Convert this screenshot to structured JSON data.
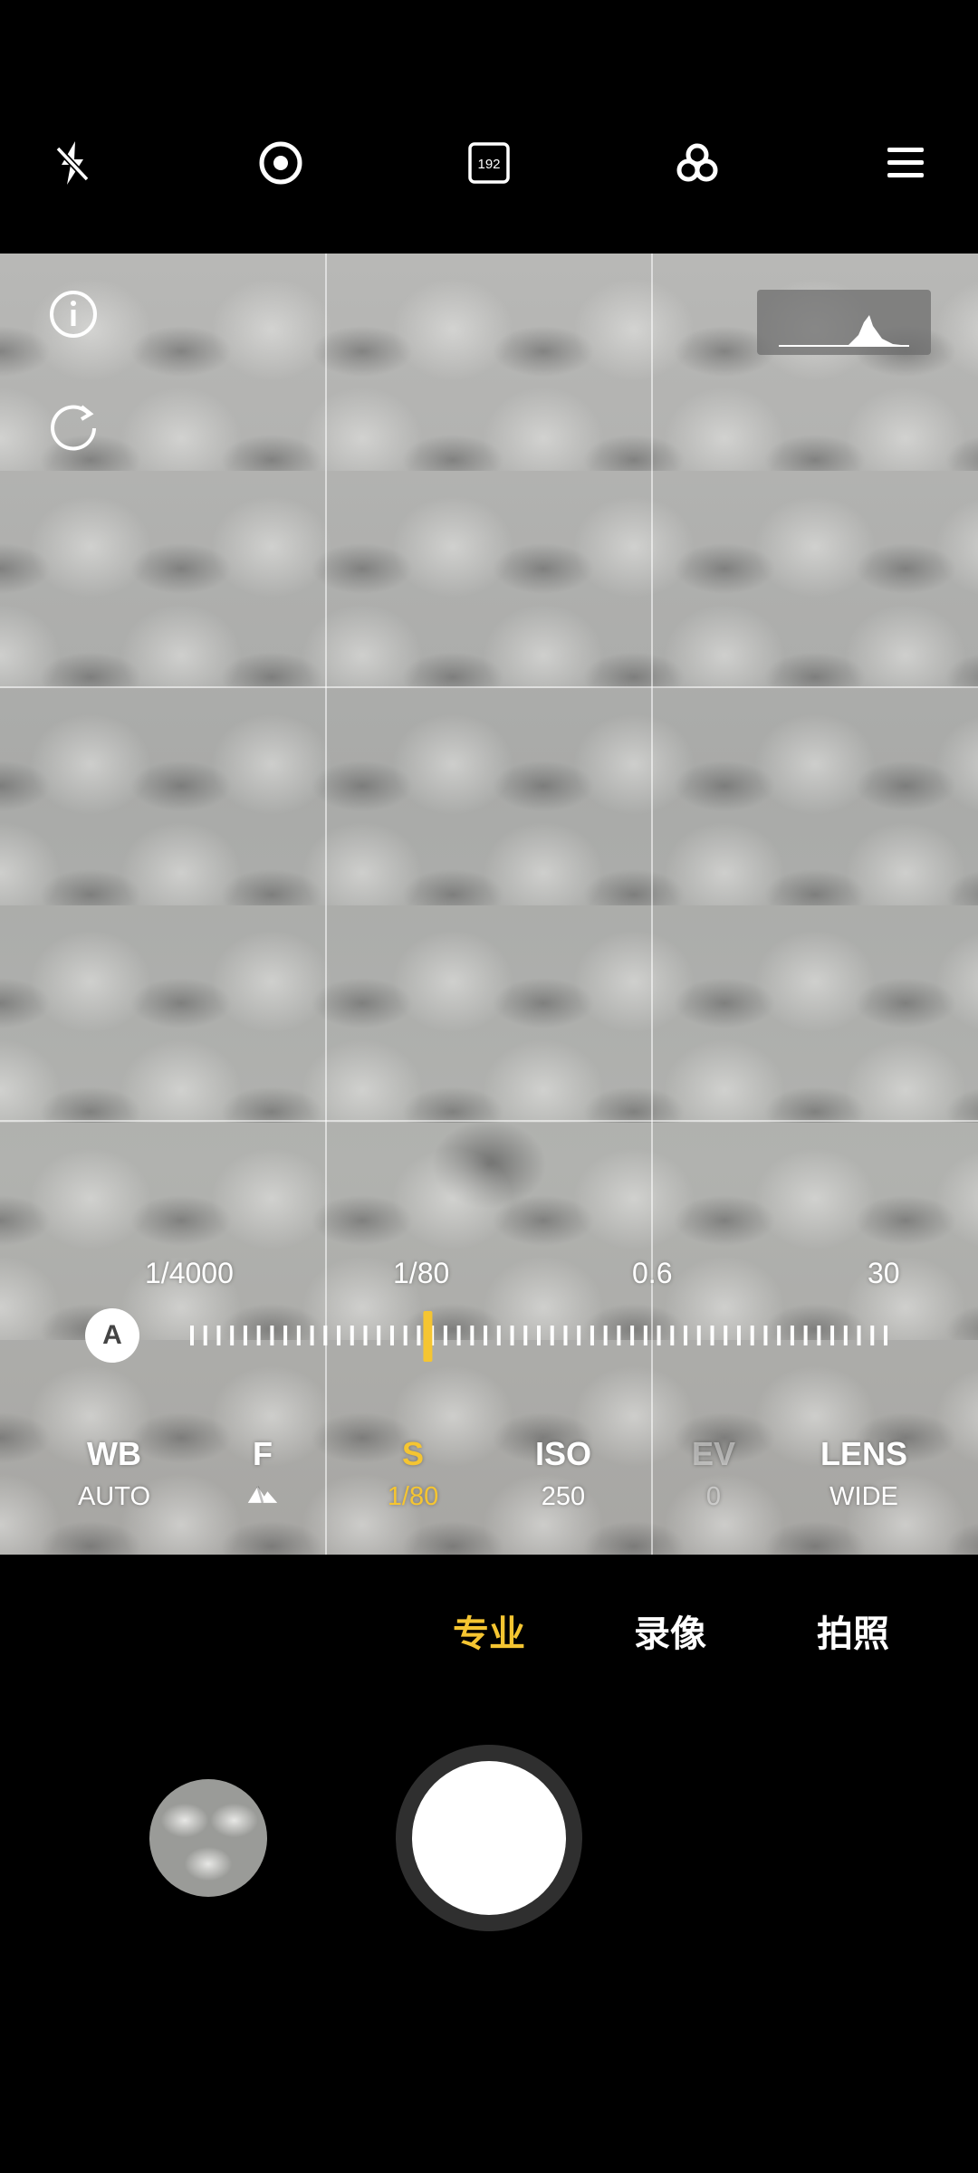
{
  "top_bar": {
    "flash_icon": "flash-off-icon",
    "focus_icon": "focus-target-icon",
    "megapixel_badge": "192",
    "filter_icon": "filter-circles-icon",
    "menu_icon": "hamburger-menu-icon"
  },
  "viewfinder": {
    "info_icon": "info-icon",
    "reset_icon": "reset-rotate-icon",
    "histogram_icon": "histogram-icon"
  },
  "shutter_scale": {
    "labels": [
      "1/4000",
      "1/80",
      "0.6",
      "30"
    ],
    "auto_label": "A",
    "selected_value": "1/80",
    "selected_fraction": 0.34
  },
  "params": [
    {
      "label": "WB",
      "value": "AUTO",
      "state": "normal"
    },
    {
      "label": "F",
      "value": "",
      "icon": "mountain-icon",
      "state": "normal"
    },
    {
      "label": "S",
      "value": "1/80",
      "state": "active"
    },
    {
      "label": "ISO",
      "value": "250",
      "state": "normal"
    },
    {
      "label": "EV",
      "value": "0",
      "state": "disabled"
    },
    {
      "label": "LENS",
      "value": "WIDE",
      "state": "normal"
    }
  ],
  "modes": [
    {
      "label": "专业",
      "active": true
    },
    {
      "label": "录像",
      "active": false
    },
    {
      "label": "拍照",
      "active": false
    }
  ],
  "bottom": {
    "thumbnail": "gallery-thumbnail",
    "shutter": "shutter-button"
  },
  "colors": {
    "accent": "#f5c531",
    "background": "#000000"
  }
}
